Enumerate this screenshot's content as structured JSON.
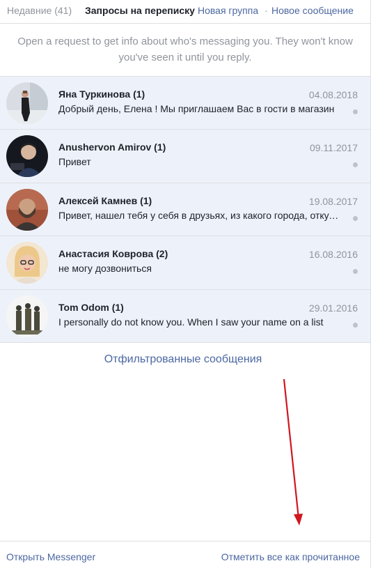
{
  "tabs": {
    "recent": "Недавние (41)",
    "requests": "Запросы на переписку",
    "separator": "·",
    "new_group": "Новая группа",
    "new_message": "Новое сообщение"
  },
  "notice": "Open a request to get info about who's messaging you. They won't know you've seen it until you reply.",
  "threads": [
    {
      "name": "Яна Туркинова (1)",
      "date": "04.08.2018",
      "preview": "Добрый день, Елена ! Мы приглашаем Вас в гости в магазин",
      "avatar_icon": "person-photo-avatar"
    },
    {
      "name": "Anushervon Amirov (1)",
      "date": "09.11.2017",
      "preview": "Привет",
      "avatar_icon": "person-photo-avatar"
    },
    {
      "name": "Алексей Камнев (1)",
      "date": "19.08.2017",
      "preview": "Привет, нашел тебя у себя в друзьях, из какого города, откуда",
      "avatar_icon": "person-photo-avatar"
    },
    {
      "name": "Анастасия Коврова (2)",
      "date": "16.08.2016",
      "preview": "не могу дозвониться",
      "avatar_icon": "person-photo-avatar"
    },
    {
      "name": "Tom Odom (1)",
      "date": "29.01.2016",
      "preview": "I personally do not know you. When I saw your name on a list",
      "avatar_icon": "statue-photo-avatar"
    }
  ],
  "filtered_link": "Отфильтрованные сообщения",
  "footer": {
    "open_messenger": "Открыть Messenger",
    "mark_all_read": "Отметить все как прочитанное"
  },
  "colors": {
    "link": "#4b67a1",
    "unread_bg": "#edf2fa",
    "muted": "#90949c",
    "annotation_arrow": "#d0161f"
  }
}
